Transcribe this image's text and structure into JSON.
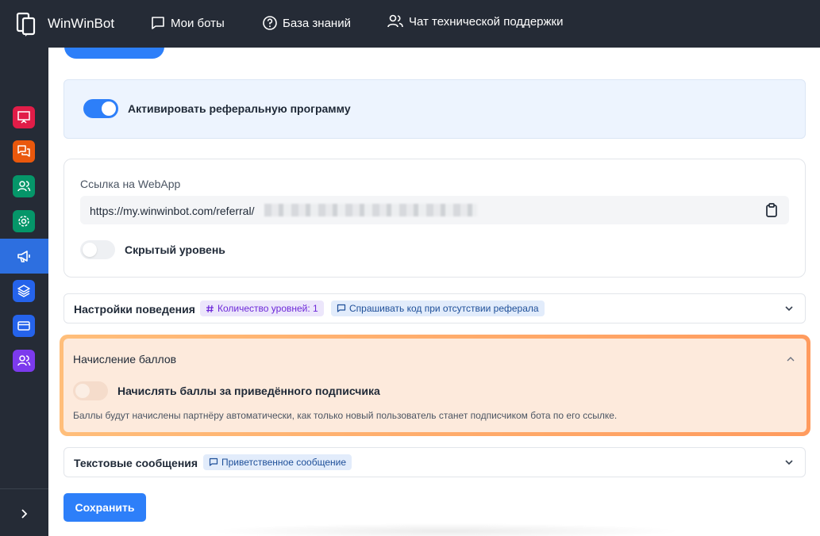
{
  "header": {
    "brand": "WinWinBot",
    "nav": [
      {
        "label": "Мои боты",
        "icon": "chat-bubble-icon"
      },
      {
        "label": "База знаний",
        "icon": "question-circle-icon"
      },
      {
        "label": "Чат технической поддержки",
        "icon": "users-icon"
      }
    ]
  },
  "sidebar": {
    "items": [
      {
        "icon": "presentation-icon",
        "color": "#e11d48"
      },
      {
        "icon": "chats-icon",
        "color": "#ea580c"
      },
      {
        "icon": "users-icon",
        "color": "#059669"
      },
      {
        "icon": "gear-icon",
        "color": "#059669"
      },
      {
        "icon": "megaphone-icon",
        "color": "#2d6fe0",
        "active": true
      },
      {
        "icon": "layers-icon",
        "color": "#2563eb"
      },
      {
        "icon": "card-icon",
        "color": "#2563eb"
      },
      {
        "icon": "users-icon",
        "color": "#7c3aed"
      }
    ]
  },
  "activation": {
    "label": "Активировать реферальную программу",
    "enabled": true
  },
  "webapp": {
    "title": "Ссылка на WebApp",
    "link_prefix": "https://my.winwinbot.com/referral/",
    "hidden_level_label": "Скрытый уровень",
    "hidden_level_enabled": false
  },
  "behavior": {
    "title": "Настройки поведения",
    "badges": [
      {
        "label": "Количество уровней: 1",
        "icon": "hash-icon"
      },
      {
        "label": "Спрашивать код при отсутствии реферала",
        "icon": "chat-bubble-icon"
      }
    ]
  },
  "points": {
    "title": "Начисление баллов",
    "toggle_label": "Начислять баллы за приведённого подписчика",
    "toggle_enabled": false,
    "description": "Баллы будут начислены партнёру автоматически, как только новый пользователь станет подписчиком бота по его ссылке."
  },
  "messages": {
    "title": "Текстовые сообщения",
    "badges": [
      {
        "label": "Приветственное сообщение",
        "icon": "chat-bubble-icon"
      }
    ]
  },
  "actions": {
    "save_label": "Сохранить"
  },
  "colors": {
    "accent": "#2d7ff9",
    "topbar": "#252b36",
    "highlight_border": "#ff9b5e"
  }
}
